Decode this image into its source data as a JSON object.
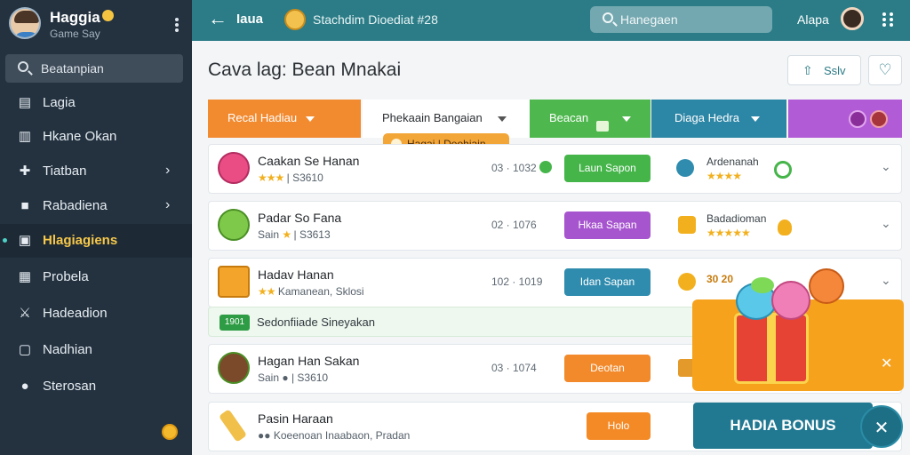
{
  "profile": {
    "name": "Haggia",
    "subtitle": "Game Say"
  },
  "sidebar": {
    "search_placeholder": "Beatanpian",
    "items": [
      {
        "label": "Lagia",
        "icon": "document-icon"
      },
      {
        "label": "Hkane Okan",
        "icon": "bar-chart-icon"
      },
      {
        "label": "Tiatban",
        "icon": "puzzle-icon"
      },
      {
        "label": "Rabadiena",
        "icon": "folder-icon"
      },
      {
        "label": "Hlagiagiens",
        "icon": "monitor-icon"
      },
      {
        "label": "Probela",
        "icon": "card-icon"
      },
      {
        "label": "Hadeadion",
        "icon": "sword-icon"
      },
      {
        "label": "Nadhian",
        "icon": "window-icon"
      },
      {
        "label": "Sterosan",
        "icon": "circle-icon"
      }
    ]
  },
  "topbar": {
    "title": "Iaua",
    "subtitle": "Stachdim Dioediat #28",
    "search_placeholder": "Hanegaen",
    "user": "Alapa"
  },
  "header": {
    "title": "Cava lag: Bean Mnakai",
    "share_label": "Sslv"
  },
  "tabs": [
    {
      "label": "Recal Hadiau"
    },
    {
      "label": "Phekaain Bangaian"
    },
    {
      "label": "Beacan"
    },
    {
      "label": "Diaga Hedra"
    }
  ],
  "tooltip": "Hagai | Deohiain",
  "rows": [
    {
      "name": "Caakan Se Hanan",
      "meta": "S3610",
      "time": "03 · 1032",
      "button": "Laun Sapon",
      "button_color": "#45b54a",
      "stat": "Ardenanah",
      "stars": "★★★",
      "rating_stars": "★★★★",
      "icon_color": "#e94d84"
    },
    {
      "name": "Padar So Fana",
      "meta": "Sain",
      "meta2": "S3613",
      "time": "02 · 1076",
      "button": "Hkaa Sapan",
      "button_color": "#a754cf",
      "stat": "Badadioman",
      "stars": "★",
      "rating_stars": "★★★★★",
      "icon_color": "#7ec94a"
    },
    {
      "name": "Hadav Hanan",
      "meta": "Kamanean, Sklosi",
      "time": "102 · 1019",
      "button": "Idan Sapan",
      "button_color": "#2f8cae",
      "stat": "30 20",
      "stars": "★★",
      "icon_color": "#f2a52a"
    },
    {
      "name": "Hagan Han Sakan",
      "meta": "Sain",
      "meta2": "S3610",
      "time": "03 · 1074",
      "button": "Deotan",
      "button_color": "#f28a2c",
      "stars": "",
      "icon_color": "#7a4a2a"
    },
    {
      "name": "Pasin Haraan",
      "meta": "Koeenoan Inaabaon, Pradan",
      "button": "Holo",
      "button_color": "#f48a25",
      "stars": "",
      "icon_color": "#f0c04a"
    }
  ],
  "notice": {
    "badge": "1901",
    "text": "Sedonfiiade Sineyakan"
  },
  "bonus": {
    "label": "HADIA BONUS"
  }
}
